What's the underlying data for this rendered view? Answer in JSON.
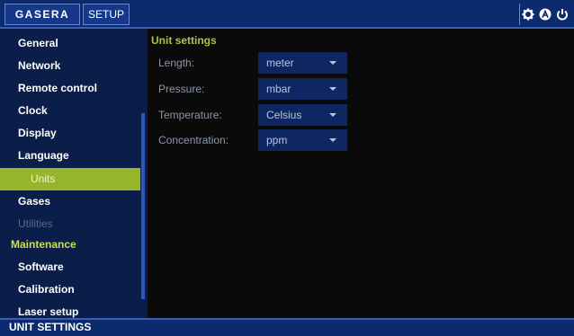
{
  "header": {
    "brand": "GASERA",
    "tab": "SETUP",
    "icons": [
      "gear-icon",
      "user-a-icon",
      "power-icon"
    ]
  },
  "sidebar": {
    "items": [
      {
        "label": "General",
        "state": "normal"
      },
      {
        "label": "Network",
        "state": "normal"
      },
      {
        "label": "Remote control",
        "state": "normal"
      },
      {
        "label": "Clock",
        "state": "normal"
      },
      {
        "label": "Display",
        "state": "normal"
      },
      {
        "label": "Language",
        "state": "normal"
      },
      {
        "label": "Units",
        "state": "selected"
      },
      {
        "label": "Gases",
        "state": "normal"
      },
      {
        "label": "Utilities",
        "state": "disabled"
      },
      {
        "label": "Maintenance",
        "state": "section"
      },
      {
        "label": "Software",
        "state": "normal"
      },
      {
        "label": "Calibration",
        "state": "normal"
      },
      {
        "label": "Laser setup",
        "state": "normal"
      }
    ]
  },
  "main": {
    "title": "Unit settings",
    "rows": [
      {
        "label": "Length:",
        "value": "meter"
      },
      {
        "label": "Pressure:",
        "value": "mbar"
      },
      {
        "label": "Temperature:",
        "value": "Celsius"
      },
      {
        "label": "Concentration:",
        "value": "ppm"
      }
    ]
  },
  "footer": {
    "label": "UNIT SETTINGS"
  },
  "colors": {
    "bar": "#0c2a6e",
    "sidebar": "#0b1e4a",
    "selected": "#97b52b",
    "accent": "#a9c544"
  }
}
